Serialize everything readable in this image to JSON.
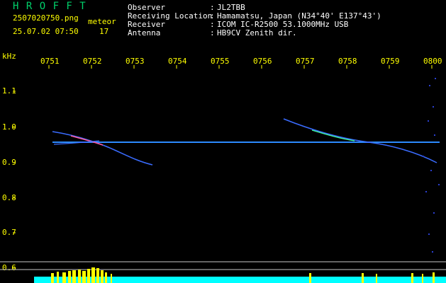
{
  "header": {
    "logo": "H R O F F T",
    "filename": "2507020750.png",
    "datetime": "25.07.02 07:50",
    "count_label": "meteor",
    "count_value": "17",
    "fields": [
      {
        "label": "Observer",
        "value": "JL2TBB"
      },
      {
        "label": "Receiving Location",
        "value": "Hamamatsu, Japan (N34°40' E137°43')"
      },
      {
        "label": "Receiver",
        "value": "ICOM IC-R2500 53.1000MHz USB"
      },
      {
        "label": "Antenna",
        "value": "HB9CV Zenith dir."
      }
    ]
  },
  "chart_data": {
    "type": "spectrogram",
    "ylabel": "kHz",
    "x_ticks": [
      "0751",
      "0752",
      "0753",
      "0754",
      "0755",
      "0756",
      "0757",
      "0758",
      "0759",
      "0800"
    ],
    "y_ticks": [
      "1.1",
      "1.0",
      "0.9",
      "0.8",
      "0.7",
      "0.6"
    ],
    "ylim": [
      0.6,
      1.1
    ],
    "carrier_khz": 0.96,
    "colors": {
      "background": "#000000",
      "text": "#ffff00",
      "logo": "#00d06a",
      "carrier": "#3a6cff",
      "activity_bar": "#00ffff",
      "activity_peak": "#ffff00"
    }
  }
}
